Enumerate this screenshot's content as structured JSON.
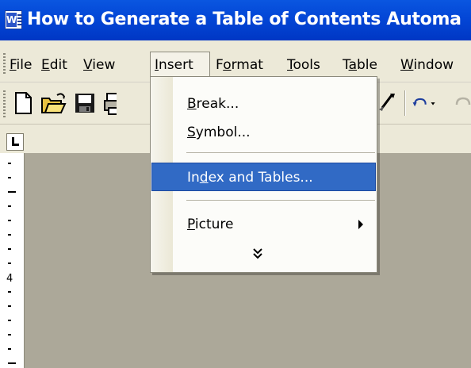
{
  "window": {
    "title": "How to Generate a Table of Contents Automa"
  },
  "menubar": {
    "items": [
      {
        "label": "File",
        "underline": "F",
        "rest": "ile"
      },
      {
        "label": "Edit",
        "underline": "E",
        "rest": "dit"
      },
      {
        "label": "View",
        "underline": "V",
        "rest": "iew"
      },
      {
        "label": "Insert",
        "underline": "I",
        "rest": "nsert",
        "open": true
      },
      {
        "label": "Format",
        "pre": "F",
        "underline": "o",
        "rest": "rmat"
      },
      {
        "label": "Tools",
        "underline": "T",
        "rest": "ools"
      },
      {
        "label": "Table",
        "pre": "T",
        "underline": "a",
        "rest": "ble"
      },
      {
        "label": "Window",
        "underline": "W",
        "rest": "indow"
      }
    ]
  },
  "toolbar": {
    "buttons": [
      "new-document-icon",
      "open-folder-icon",
      "save-disk-icon",
      "print-icon",
      "format-painter-icon",
      "undo-icon"
    ]
  },
  "ruler": {
    "vertical_number": "4"
  },
  "insert_menu": {
    "items": [
      {
        "label": "Break...",
        "underline": "B",
        "rest": "reak..."
      },
      {
        "label": "Symbol...",
        "underline": "S",
        "rest": "ymbol..."
      },
      {
        "label": "Index and Tables...",
        "pre": "In",
        "underline": "d",
        "rest": "ex and Tables...",
        "highlighted": true
      },
      {
        "label": "Picture",
        "underline": "P",
        "rest": "icture",
        "has_submenu": true
      }
    ],
    "expand_icon": "double-chevron-down-icon"
  },
  "colors": {
    "titlebar": "#0346d6",
    "menu_highlight": "#316ac5",
    "chrome": "#ece9d8",
    "workspace": "#aca899"
  }
}
